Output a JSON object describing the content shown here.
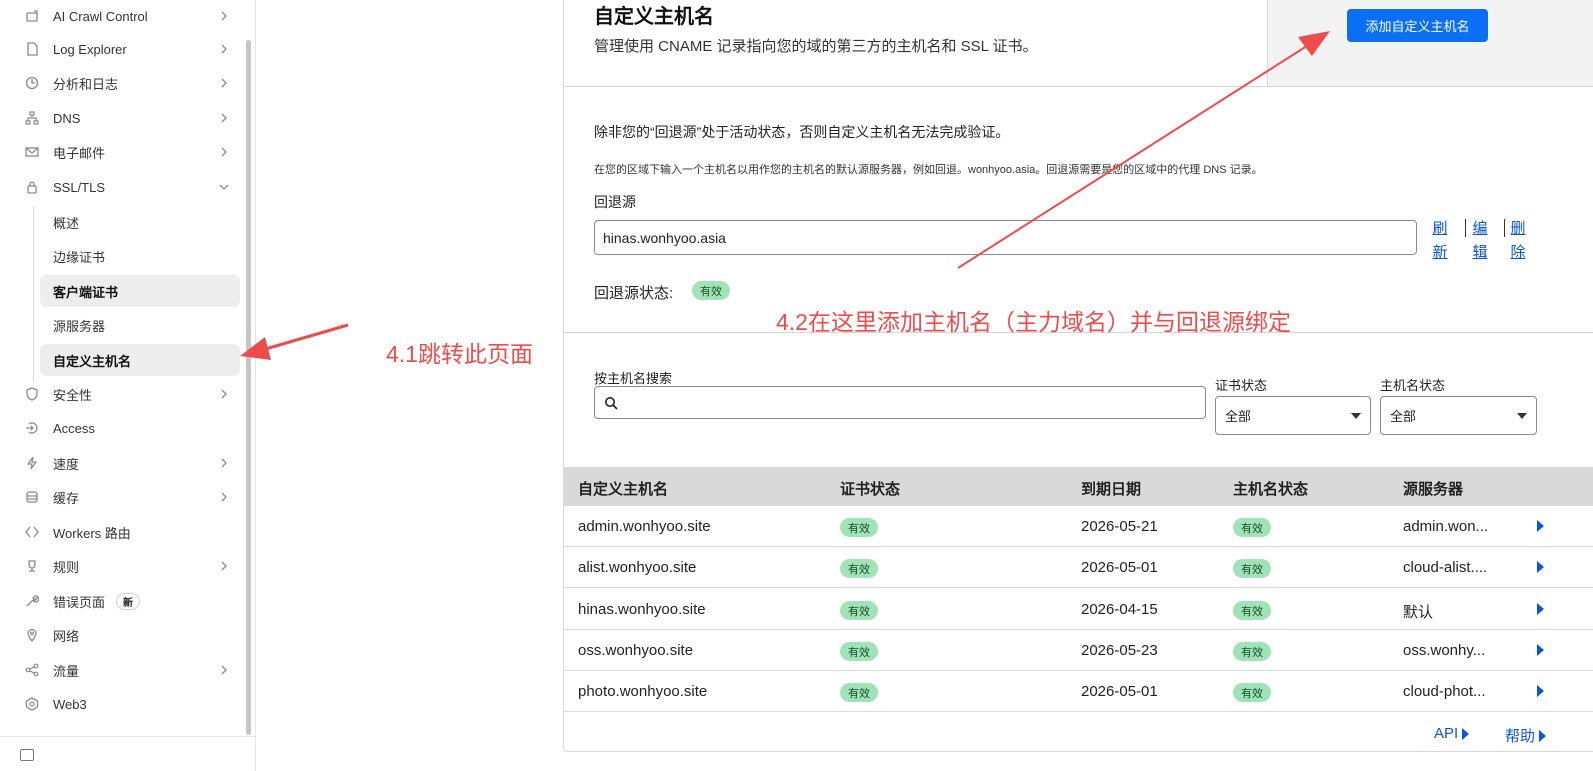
{
  "sidebar": {
    "items": [
      {
        "label": "AI Crawl Control",
        "icon": "robot-icon",
        "chevron": "right"
      },
      {
        "label": "Log Explorer",
        "icon": "file-search-icon",
        "chevron": "right"
      },
      {
        "label": "分析和日志",
        "icon": "chart-clock-icon",
        "chevron": "right"
      },
      {
        "label": "DNS",
        "icon": "network-icon",
        "chevron": "right"
      },
      {
        "label": "电子邮件",
        "icon": "mail-icon",
        "chevron": "right"
      },
      {
        "label": "SSL/TLS",
        "icon": "lock-icon",
        "chevron": "down"
      },
      {
        "label": "安全性",
        "icon": "shield-icon",
        "chevron": "right"
      },
      {
        "label": "Access",
        "icon": "access-icon",
        "chevron": ""
      },
      {
        "label": "速度",
        "icon": "bolt-icon",
        "chevron": "right"
      },
      {
        "label": "缓存",
        "icon": "database-icon",
        "chevron": "right"
      },
      {
        "label": "Workers 路由",
        "icon": "workers-icon",
        "chevron": ""
      },
      {
        "label": "规则",
        "icon": "trophy-icon",
        "chevron": "right"
      },
      {
        "label": "错误页面",
        "icon": "wrench-icon",
        "chevron": "",
        "badge": "新"
      },
      {
        "label": "网络",
        "icon": "location-pin-icon",
        "chevron": ""
      },
      {
        "label": "流量",
        "icon": "share-nodes-icon",
        "chevron": "right"
      },
      {
        "label": "Web3",
        "icon": "web3-icon",
        "chevron": ""
      }
    ],
    "sub_items": [
      {
        "label": "概述",
        "active": false
      },
      {
        "label": "边缘证书",
        "active": false
      },
      {
        "label": "客户端证书",
        "active": true
      },
      {
        "label": "源服务器",
        "active": false
      },
      {
        "label": "自定义主机名",
        "active": true
      }
    ]
  },
  "header": {
    "title": "自定义主机名",
    "description": "管理使用 CNAME 记录指向您的域的第三方的主机名和 SSL 证书。",
    "add_button": "添加自定义主机名"
  },
  "fallback": {
    "warning": "除非您的“回退源”处于活动状态，否则自定义主机名无法完成验证。",
    "hint": "在您的区域下输入一个主机名以用作您的主机名的默认源服务器，例如回退。wonhyoo.asia。回退源需要是您的区域中的代理 DNS 记录。",
    "label": "回退源",
    "value": "hinas.wonhyoo.asia",
    "actions": {
      "refresh_1": "刷",
      "refresh_2": "新",
      "edit_1": "编",
      "edit_2": "辑",
      "delete_1": "删",
      "delete_2": "除"
    },
    "status_label": "回退源状态:",
    "status_value": "有效"
  },
  "filters": {
    "search_label": "按主机名搜索",
    "search_value": "",
    "cert_status_label": "证书状态",
    "cert_status_value": "全部",
    "host_status_label": "主机名状态",
    "host_status_value": "全部"
  },
  "table": {
    "columns": [
      "自定义主机名",
      "证书状态",
      "到期日期",
      "主机名状态",
      "源服务器"
    ],
    "rows": [
      {
        "host": "admin.wonhyoo.site",
        "cert": "有效",
        "expiry": "2026-05-21",
        "status": "有效",
        "origin": "admin.won..."
      },
      {
        "host": "alist.wonhyoo.site",
        "cert": "有效",
        "expiry": "2026-05-01",
        "status": "有效",
        "origin": "cloud-alist...."
      },
      {
        "host": "hinas.wonhyoo.site",
        "cert": "有效",
        "expiry": "2026-04-15",
        "status": "有效",
        "origin": "默认"
      },
      {
        "host": "oss.wonhyoo.site",
        "cert": "有效",
        "expiry": "2026-05-23",
        "status": "有效",
        "origin": "oss.wonhy..."
      },
      {
        "host": "photo.wonhyoo.site",
        "cert": "有效",
        "expiry": "2026-05-01",
        "status": "有效",
        "origin": "cloud-phot..."
      }
    ]
  },
  "footer": {
    "api": "API",
    "help": "帮助"
  },
  "annotations": {
    "a1": "4.1跳转此页面",
    "a2": "4.2在这里添加主机名（主力域名）并与回退源绑定"
  },
  "colors": {
    "accent": "#0a6ff5",
    "annotation": "#ee4b4b",
    "pill_bg": "#9fe3b6"
  }
}
